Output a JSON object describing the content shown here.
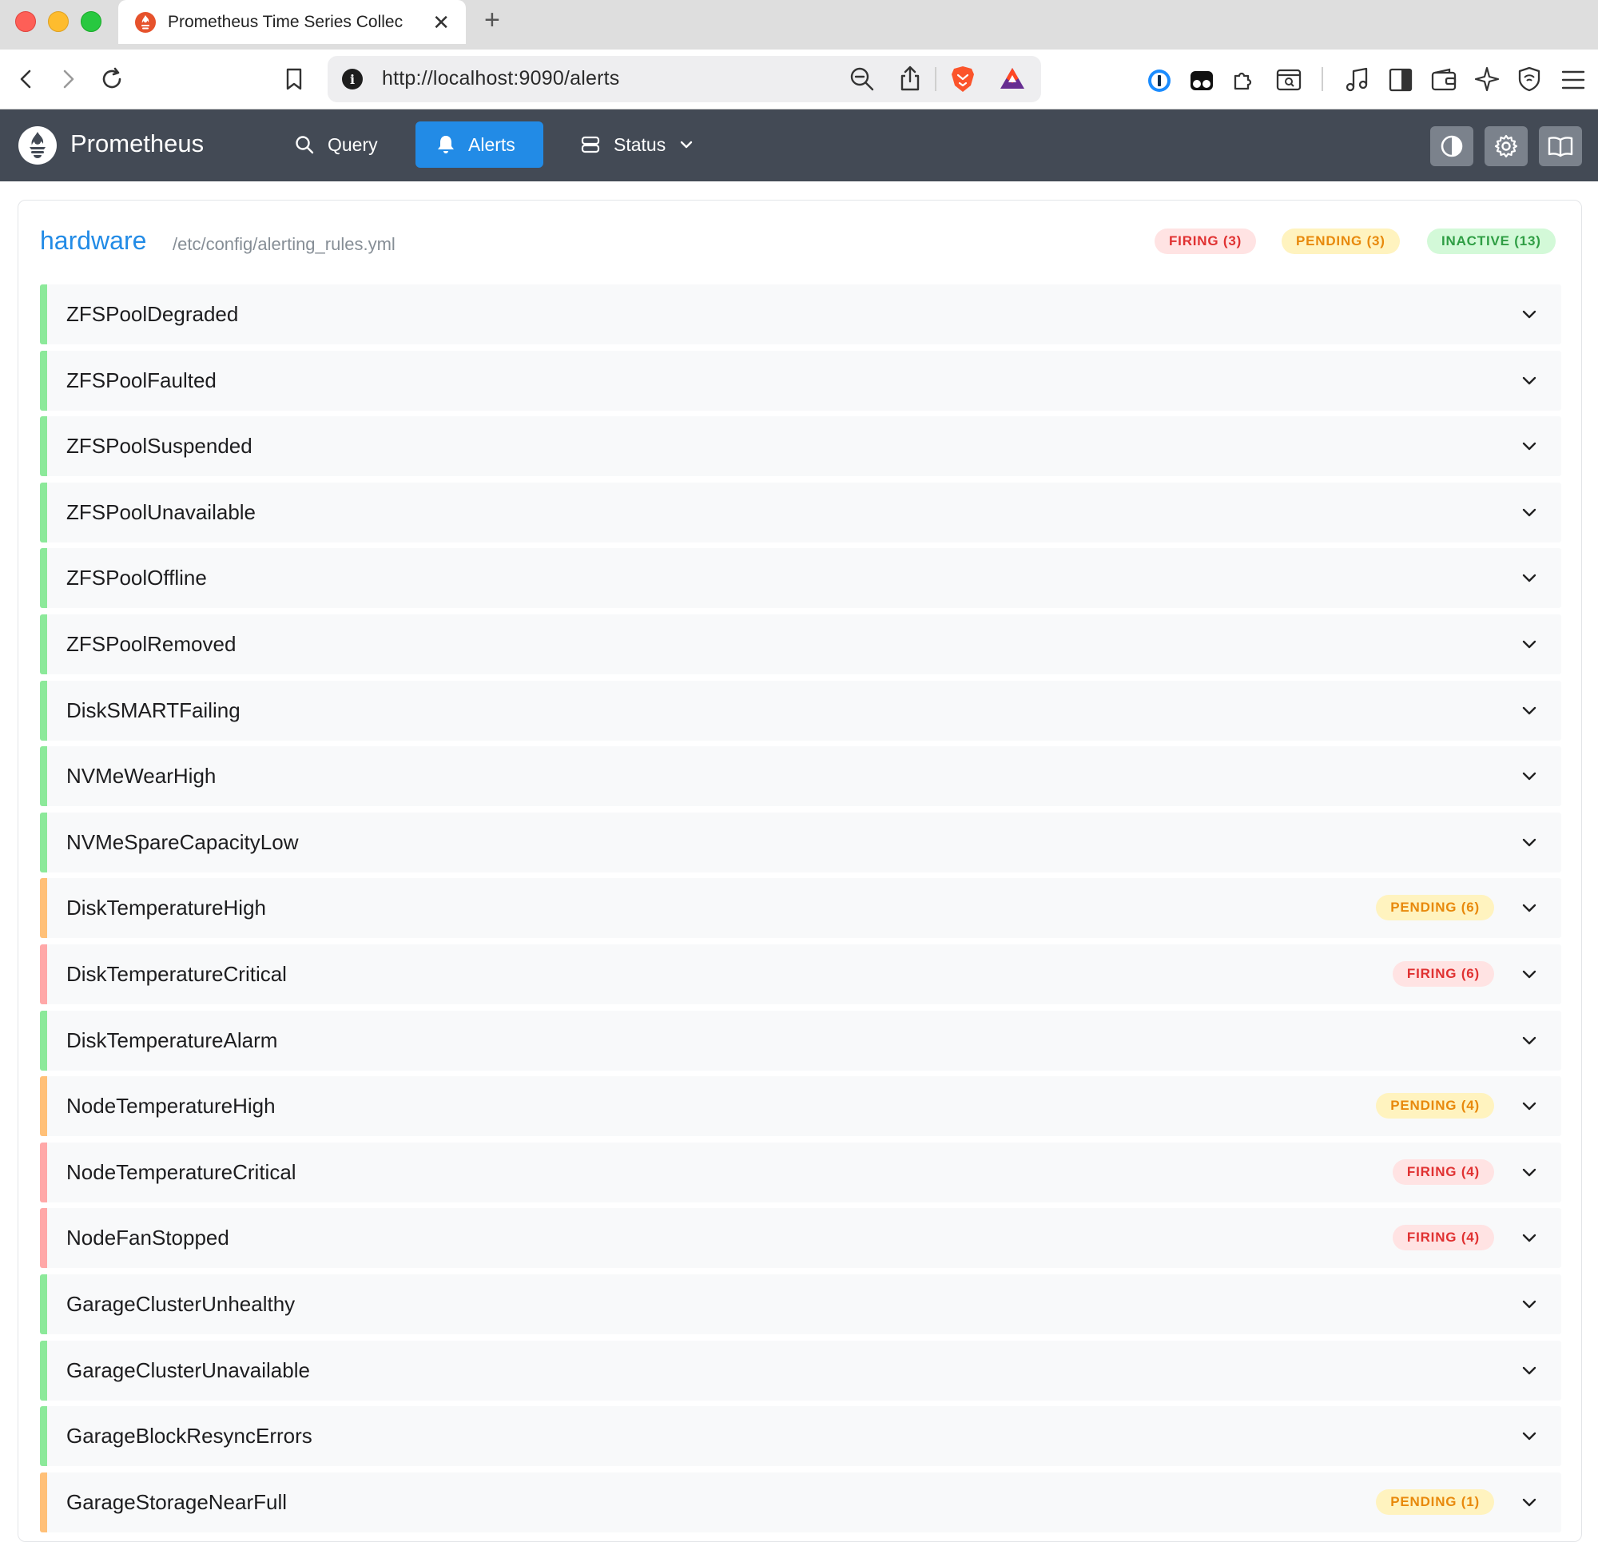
{
  "browser": {
    "tab_title": "Prometheus Time Series Collec",
    "tab_close": "✕",
    "new_tab": "+",
    "url": "http://localhost:9090/alerts",
    "url_info": "i"
  },
  "app": {
    "brand": "Prometheus",
    "nav": [
      {
        "label": "Query",
        "icon": "search-icon"
      },
      {
        "label": "Alerts",
        "icon": "bell-icon",
        "active": true
      },
      {
        "label": "Status",
        "icon": "server-icon"
      }
    ],
    "tools": [
      "theme-toggle-icon",
      "gear-icon",
      "book-icon"
    ],
    "accent_color": "#228be6",
    "header_color": "#434a55"
  },
  "group": {
    "name": "hardware",
    "file": "/etc/config/alerting_rules.yml",
    "summary": {
      "firing": "FIRING (3)",
      "pending": "PENDING (3)",
      "inactive": "INACTIVE (13)"
    }
  },
  "state_colors": {
    "inactive": "#8ce99a",
    "pending": "#ffc078",
    "firing": "#ffa8a8"
  },
  "rules": [
    {
      "name": "ZFSPoolDegraded",
      "state": "inactive",
      "badge": ""
    },
    {
      "name": "ZFSPoolFaulted",
      "state": "inactive",
      "badge": ""
    },
    {
      "name": "ZFSPoolSuspended",
      "state": "inactive",
      "badge": ""
    },
    {
      "name": "ZFSPoolUnavailable",
      "state": "inactive",
      "badge": ""
    },
    {
      "name": "ZFSPoolOffline",
      "state": "inactive",
      "badge": ""
    },
    {
      "name": "ZFSPoolRemoved",
      "state": "inactive",
      "badge": ""
    },
    {
      "name": "DiskSMARTFailing",
      "state": "inactive",
      "badge": ""
    },
    {
      "name": "NVMeWearHigh",
      "state": "inactive",
      "badge": ""
    },
    {
      "name": "NVMeSpareCapacityLow",
      "state": "inactive",
      "badge": ""
    },
    {
      "name": "DiskTemperatureHigh",
      "state": "pending",
      "badge": "PENDING (6)"
    },
    {
      "name": "DiskTemperatureCritical",
      "state": "firing",
      "badge": "FIRING (6)"
    },
    {
      "name": "DiskTemperatureAlarm",
      "state": "inactive",
      "badge": ""
    },
    {
      "name": "NodeTemperatureHigh",
      "state": "pending",
      "badge": "PENDING (4)"
    },
    {
      "name": "NodeTemperatureCritical",
      "state": "firing",
      "badge": "FIRING (4)"
    },
    {
      "name": "NodeFanStopped",
      "state": "firing",
      "badge": "FIRING (4)"
    },
    {
      "name": "GarageClusterUnhealthy",
      "state": "inactive",
      "badge": ""
    },
    {
      "name": "GarageClusterUnavailable",
      "state": "inactive",
      "badge": ""
    },
    {
      "name": "GarageBlockResyncErrors",
      "state": "inactive",
      "badge": ""
    },
    {
      "name": "GarageStorageNearFull",
      "state": "pending",
      "badge": "PENDING (1)"
    }
  ]
}
